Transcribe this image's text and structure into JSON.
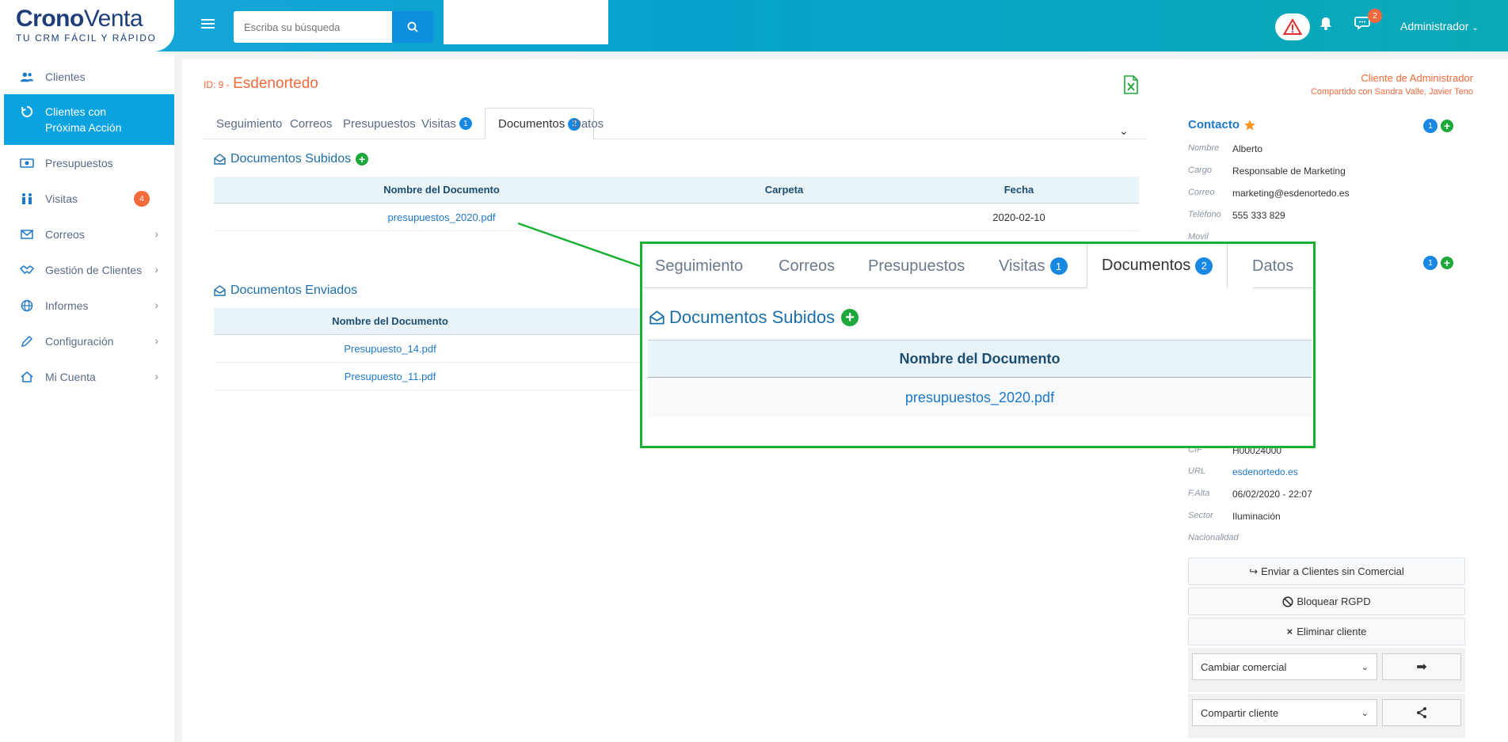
{
  "brand": {
    "logo_part1": "Crono",
    "logo_part2": "Venta",
    "tagline": "TU CRM FÁCIL Y RÁPIDO"
  },
  "header": {
    "search_placeholder": "Escriba su búsqueda",
    "chat_count": "2",
    "user": "Administrador"
  },
  "sidebar": {
    "items": [
      {
        "label": "Clientes",
        "icon": "users-icon"
      },
      {
        "label": "Clientes con Próxima Acción",
        "icon": "refresh-icon",
        "active": true
      },
      {
        "label": "Presupuestos",
        "icon": "money-icon"
      },
      {
        "label": "Visitas",
        "icon": "people-icon",
        "badge": "4"
      },
      {
        "label": "Correos",
        "icon": "envelope-icon"
      },
      {
        "label": "Gestión de Clientes",
        "icon": "handshake-icon"
      },
      {
        "label": "Informes",
        "icon": "globe-icon"
      },
      {
        "label": "Configuración",
        "icon": "pencil-icon"
      },
      {
        "label": "Mi Cuenta",
        "icon": "home-icon"
      }
    ]
  },
  "client": {
    "id_prefix": "ID: 9 -",
    "name": "Esdenortedo",
    "owner": "Cliente de Administrador",
    "shared": "Compartido con Sandra Valle, Javier Teno"
  },
  "tabs": [
    {
      "label": "Seguimiento"
    },
    {
      "label": "Correos"
    },
    {
      "label": "Presupuestos"
    },
    {
      "label": "Visitas",
      "count": "1"
    },
    {
      "label": "Documentos",
      "count": "2",
      "active": true
    },
    {
      "label": "Datos"
    }
  ],
  "uploaded": {
    "title": "Documentos Subidos",
    "columns": [
      "Nombre del Documento",
      "Carpeta",
      "Fecha"
    ],
    "rows": [
      {
        "name": "presupuestos_2020.pdf",
        "folder": "",
        "date": "2020-02-10"
      }
    ]
  },
  "sent": {
    "title": "Documentos Enviados",
    "columns": [
      "Nombre del Documento"
    ],
    "rows": [
      {
        "name": "Presupuesto_14.pdf"
      },
      {
        "name": "Presupuesto_11.pdf"
      }
    ]
  },
  "contact": {
    "title": "Contacto",
    "count": "1",
    "fields": [
      {
        "key": "Nombre",
        "value": "Alberto"
      },
      {
        "key": "Cargo",
        "value": "Responsable de Marketing"
      },
      {
        "key": "Correo",
        "value": "marketing@esdenortedo.es"
      },
      {
        "key": "Teléfono",
        "value": "555 333 829"
      },
      {
        "key": "Movil",
        "value": ""
      }
    ],
    "second_count": "1"
  },
  "company": {
    "fields": [
      {
        "key": "CIF",
        "value": "H00024000"
      },
      {
        "key": "URL",
        "value": "esdenortedo.es",
        "link": true
      },
      {
        "key": "F.Alta",
        "value": "06/02/2020 - 22:07"
      },
      {
        "key": "Sector",
        "value": "Iluminación"
      },
      {
        "key": "Nacionalidad",
        "value": ""
      }
    ]
  },
  "actions": {
    "send_no_sales": "Enviar a Clientes sin Comercial",
    "block_rgpd": "Bloquear RGPD",
    "delete_client": "Eliminar cliente",
    "change_sales": "Cambiar comercial",
    "share_client": "Compartir cliente"
  },
  "callout": {
    "tabs": [
      {
        "label": "Seguimiento"
      },
      {
        "label": "Correos"
      },
      {
        "label": "Presupuestos"
      },
      {
        "label": "Visitas",
        "count": "1"
      },
      {
        "label": "Documentos",
        "count": "2",
        "active": true
      },
      {
        "label": "Datos"
      }
    ],
    "title": "Documentos Subidos",
    "column": "Nombre del Documento",
    "row": "presupuestos_2020.pdf"
  },
  "colors": {
    "accent": "#0aa3e0",
    "orange": "#f06a3a",
    "green": "#1ab034",
    "link": "#1e78c8"
  }
}
